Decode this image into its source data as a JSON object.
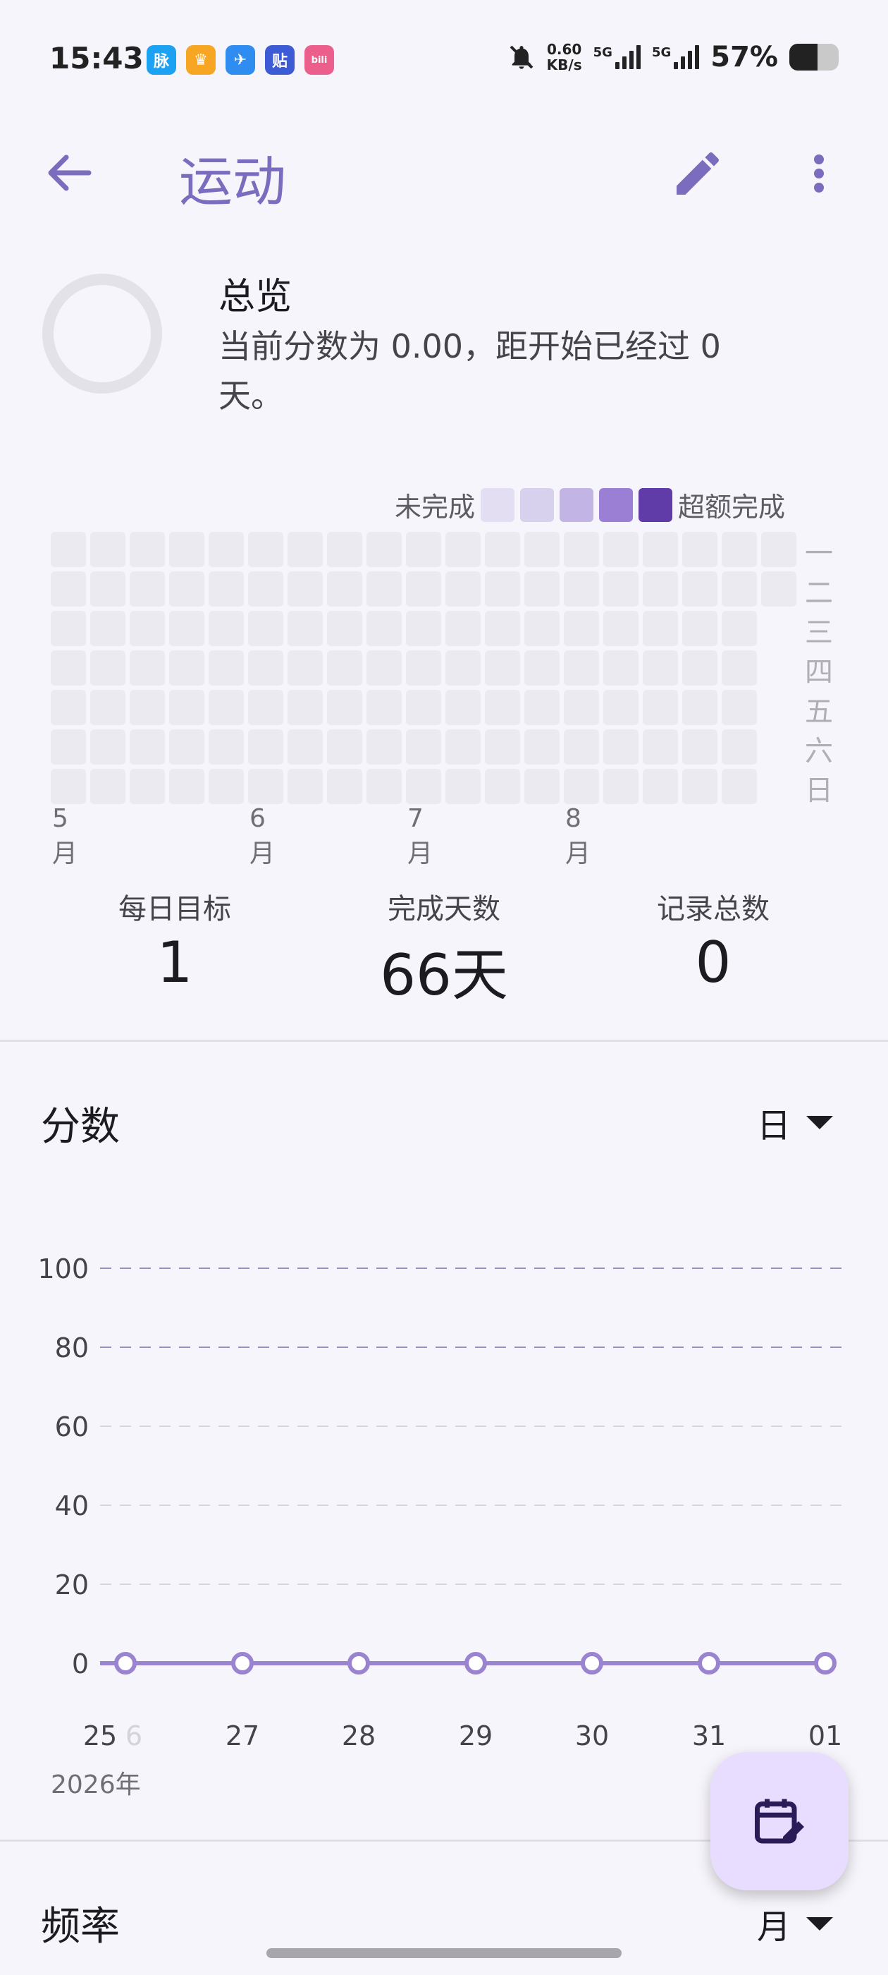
{
  "status_bar": {
    "time": "15:43",
    "net_speed_value": "0.60",
    "net_speed_unit": "KB/s",
    "signal1": "5G",
    "signal2": "5G",
    "battery_percent": "57%",
    "battery_level": 0.57,
    "app_icons": [
      {
        "name": "maimai-app-icon",
        "glyph": "脉",
        "color": "#1da1f2"
      },
      {
        "name": "crown-app-icon",
        "glyph": "♛",
        "color": "#f6a623"
      },
      {
        "name": "feather-app-icon",
        "glyph": "✈",
        "color": "#2f8cf0"
      },
      {
        "name": "tieba-app-icon",
        "glyph": "贴",
        "color": "#3e5bd6"
      },
      {
        "name": "bilibili-app-icon",
        "glyph": "bili",
        "color": "#ec5f8c"
      }
    ]
  },
  "header": {
    "title": "运动"
  },
  "overview": {
    "title": "总览",
    "description": "当前分数为 0.00，距开始已经过 0 天。"
  },
  "heatmap": {
    "legend_less": "未完成",
    "legend_more": "超额完成",
    "legend_colors": [
      "#e3def2",
      "#d8d1ee",
      "#c2b4e4",
      "#9a7fd4",
      "#5f3ca8"
    ],
    "months": [
      "5月",
      "6月",
      "7月",
      "8月"
    ],
    "weekdays": [
      "一",
      "二",
      "三",
      "四",
      "五",
      "六",
      "日"
    ],
    "cell_color": "#ebeaf0"
  },
  "stats": [
    {
      "label": "每日目标",
      "value": "1"
    },
    {
      "label": "完成天数",
      "value": "66天"
    },
    {
      "label": "记录总数",
      "value": "0"
    }
  ],
  "score_section": {
    "title": "分数",
    "period": "日"
  },
  "frequency_section": {
    "title": "频率",
    "period": "月"
  },
  "chart_data": {
    "type": "line",
    "x": [
      "25",
      "27",
      "28",
      "29",
      "30",
      "31",
      "01"
    ],
    "x_partial_label": "6",
    "x_year_label": "2026年",
    "values": [
      0,
      0,
      0,
      0,
      0,
      0,
      0
    ],
    "yticks": [
      0,
      20,
      40,
      60,
      80,
      100
    ],
    "ylim": [
      0,
      100
    ],
    "grid": true,
    "line_color": "#9a84d0"
  },
  "accent_color": "#7c6cbe"
}
